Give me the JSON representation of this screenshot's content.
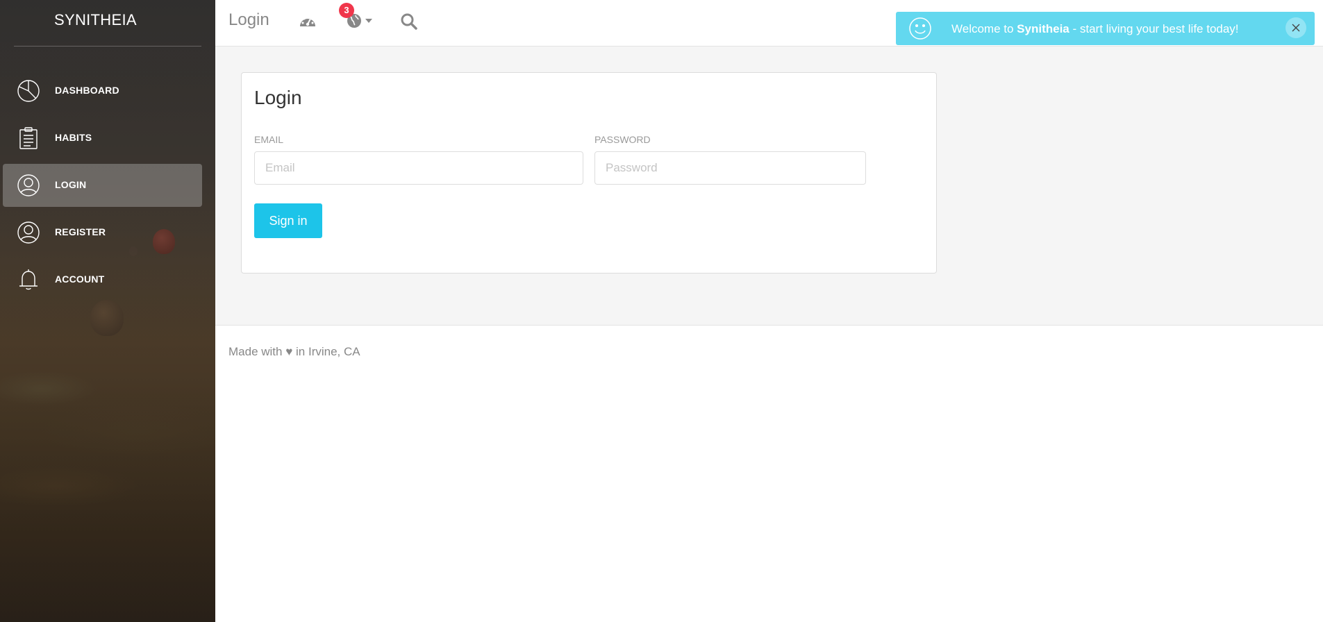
{
  "brand": {
    "name": "SYNITHEIA"
  },
  "sidebar": {
    "items": [
      {
        "label": "DASHBOARD",
        "icon": "pie-chart-icon",
        "active": false
      },
      {
        "label": "HABITS",
        "icon": "clipboard-icon",
        "active": false
      },
      {
        "label": "LOGIN",
        "icon": "user-icon",
        "active": true
      },
      {
        "label": "REGISTER",
        "icon": "user-icon",
        "active": false
      },
      {
        "label": "ACCOUNT",
        "icon": "bell-icon",
        "active": false
      }
    ]
  },
  "topbar": {
    "title": "Login",
    "notification_count": "3",
    "icons": [
      "dashboard-gauge-icon",
      "globe-icon",
      "search-icon"
    ]
  },
  "notification": {
    "prefix": "Welcome to ",
    "brand": "Synitheia",
    "suffix": " - start living your best life today!",
    "color": "#63d8ef"
  },
  "login_card": {
    "title": "Login",
    "email_label": "EMAIL",
    "email_placeholder": "Email",
    "email_value": "",
    "password_label": "PASSWORD",
    "password_placeholder": "Password",
    "password_value": "",
    "submit_label": "Sign in",
    "accent": "#1dc4e9"
  },
  "footer": {
    "text": "Made with ♥ in Irvine, CA"
  }
}
